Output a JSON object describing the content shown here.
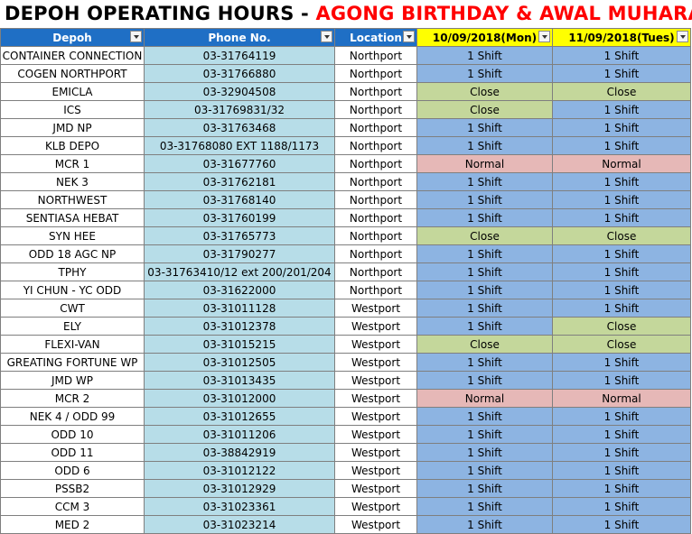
{
  "title": {
    "part1": "DEPOH OPERATING HOURS - ",
    "part2": "AGONG BIRTHDAY & AWAL MUHARAM"
  },
  "headers": [
    "Depoh",
    "Phone No.",
    "Location",
    "10/09/2018(Mon)",
    "11/09/2018(Tues)"
  ],
  "colors": {
    "header_blue": "#1f6fc5",
    "header_yellow": "#ffff00",
    "phone_bg": "#b7dde8",
    "shift_bg": "#8db4e2",
    "close_bg": "#c4d79b",
    "normal_bg": "#e6b8b7",
    "title_red": "#ff0000"
  },
  "rows": [
    [
      "CONTAINER CONNECTION",
      "03-31764119",
      "Northport",
      "1 Shift",
      "1 Shift"
    ],
    [
      "COGEN NORTHPORT",
      "03-31766880",
      "Northport",
      "1 Shift",
      "1 Shift"
    ],
    [
      "EMICLA",
      "03-32904508",
      "Northport",
      "Close",
      "Close"
    ],
    [
      "ICS",
      "03-31769831/32",
      "Northport",
      "Close",
      "1 Shift"
    ],
    [
      "JMD NP",
      "03-31763468",
      "Northport",
      "1 Shift",
      "1 Shift"
    ],
    [
      "KLB DEPO",
      "03-31768080 EXT 1188/1173",
      "Northport",
      "1 Shift",
      "1 Shift"
    ],
    [
      "MCR 1",
      "03-31677760",
      "Northport",
      "Normal",
      "Normal"
    ],
    [
      "NEK 3",
      "03-31762181",
      "Northport",
      "1 Shift",
      "1 Shift"
    ],
    [
      "NORTHWEST",
      "03-31768140",
      "Northport",
      "1 Shift",
      "1 Shift"
    ],
    [
      "SENTIASA HEBAT",
      "03-31760199",
      "Northport",
      "1 Shift",
      "1 Shift"
    ],
    [
      "SYN HEE",
      "03-31765773",
      "Northport",
      "Close",
      "Close"
    ],
    [
      "ODD 18 AGC NP",
      "03-31790277",
      "Northport",
      "1 Shift",
      "1 Shift"
    ],
    [
      "TPHY",
      "03-31763410/12 ext 200/201/204",
      "Northport",
      "1 Shift",
      "1 Shift"
    ],
    [
      "YI CHUN - YC ODD",
      "03-31622000",
      "Northport",
      "1 Shift",
      "1 Shift"
    ],
    [
      "CWT",
      "03-31011128",
      "Westport",
      "1 Shift",
      "1 Shift"
    ],
    [
      "ELY",
      "03-31012378",
      "Westport",
      "1 Shift",
      "Close"
    ],
    [
      "FLEXI-VAN",
      "03-31015215",
      "Westport",
      "Close",
      "Close"
    ],
    [
      "GREATING FORTUNE WP",
      "03-31012505",
      "Westport",
      "1 Shift",
      "1 Shift"
    ],
    [
      "JMD WP",
      "03-31013435",
      "Westport",
      "1 Shift",
      "1 Shift"
    ],
    [
      "MCR 2",
      "03-31012000",
      "Westport",
      "Normal",
      "Normal"
    ],
    [
      "NEK 4 / ODD 99",
      "03-31012655",
      "Westport",
      "1 Shift",
      "1 Shift"
    ],
    [
      "ODD 10",
      "03-31011206",
      "Westport",
      "1 Shift",
      "1 Shift"
    ],
    [
      "ODD 11",
      "03-38842919",
      "Westport",
      "1 Shift",
      "1 Shift"
    ],
    [
      "ODD 6",
      "03-31012122",
      "Westport",
      "1 Shift",
      "1 Shift"
    ],
    [
      "PSSB2",
      "03-31012929",
      "Westport",
      "1 Shift",
      "1 Shift"
    ],
    [
      "CCM 3",
      "03-31023361",
      "Westport",
      "1 Shift",
      "1 Shift"
    ],
    [
      "MED 2",
      "03-31023214",
      "Westport",
      "1 Shift",
      "1 Shift"
    ]
  ]
}
